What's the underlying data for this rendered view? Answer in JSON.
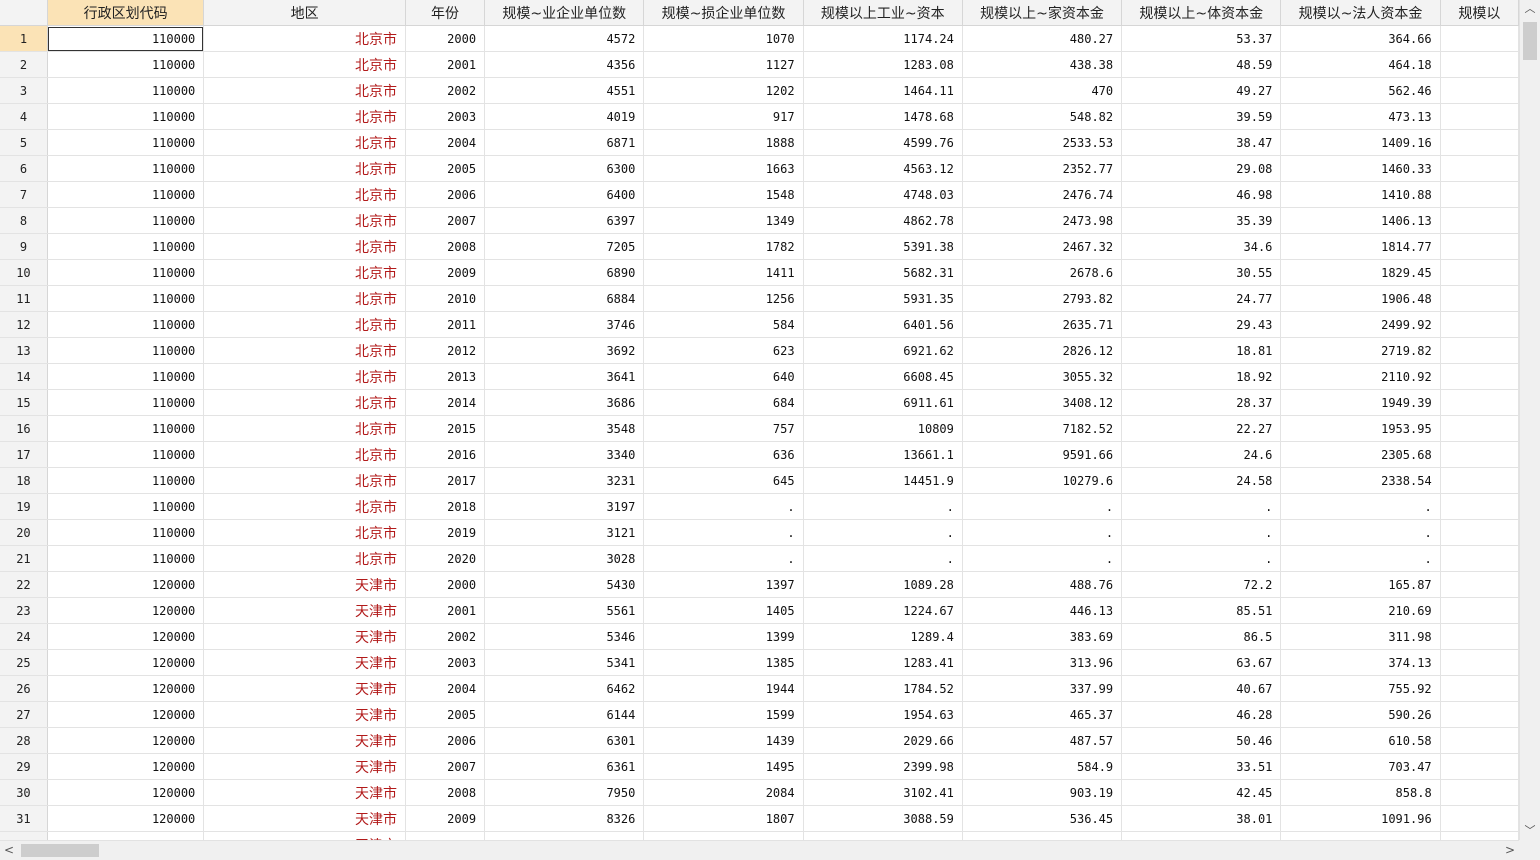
{
  "columns": [
    "行政区划代码",
    "地区",
    "年份",
    "规模~业企业单位数",
    "规模~损企业单位数",
    "规模以上工业~资本",
    "规模以上~家资本金",
    "规模以上~体资本金",
    "规模以~法人资本金",
    "规模以"
  ],
  "rows": [
    [
      "1",
      "110000",
      "北京市",
      "2000",
      "4572",
      "1070",
      "1174.24",
      "480.27",
      "53.37",
      "364.66",
      ""
    ],
    [
      "2",
      "110000",
      "北京市",
      "2001",
      "4356",
      "1127",
      "1283.08",
      "438.38",
      "48.59",
      "464.18",
      ""
    ],
    [
      "3",
      "110000",
      "北京市",
      "2002",
      "4551",
      "1202",
      "1464.11",
      "470",
      "49.27",
      "562.46",
      ""
    ],
    [
      "4",
      "110000",
      "北京市",
      "2003",
      "4019",
      "917",
      "1478.68",
      "548.82",
      "39.59",
      "473.13",
      ""
    ],
    [
      "5",
      "110000",
      "北京市",
      "2004",
      "6871",
      "1888",
      "4599.76",
      "2533.53",
      "38.47",
      "1409.16",
      ""
    ],
    [
      "6",
      "110000",
      "北京市",
      "2005",
      "6300",
      "1663",
      "4563.12",
      "2352.77",
      "29.08",
      "1460.33",
      ""
    ],
    [
      "7",
      "110000",
      "北京市",
      "2006",
      "6400",
      "1548",
      "4748.03",
      "2476.74",
      "46.98",
      "1410.88",
      ""
    ],
    [
      "8",
      "110000",
      "北京市",
      "2007",
      "6397",
      "1349",
      "4862.78",
      "2473.98",
      "35.39",
      "1406.13",
      ""
    ],
    [
      "9",
      "110000",
      "北京市",
      "2008",
      "7205",
      "1782",
      "5391.38",
      "2467.32",
      "34.6",
      "1814.77",
      ""
    ],
    [
      "10",
      "110000",
      "北京市",
      "2009",
      "6890",
      "1411",
      "5682.31",
      "2678.6",
      "30.55",
      "1829.45",
      ""
    ],
    [
      "11",
      "110000",
      "北京市",
      "2010",
      "6884",
      "1256",
      "5931.35",
      "2793.82",
      "24.77",
      "1906.48",
      ""
    ],
    [
      "12",
      "110000",
      "北京市",
      "2011",
      "3746",
      "584",
      "6401.56",
      "2635.71",
      "29.43",
      "2499.92",
      ""
    ],
    [
      "13",
      "110000",
      "北京市",
      "2012",
      "3692",
      "623",
      "6921.62",
      "2826.12",
      "18.81",
      "2719.82",
      ""
    ],
    [
      "14",
      "110000",
      "北京市",
      "2013",
      "3641",
      "640",
      "6608.45",
      "3055.32",
      "18.92",
      "2110.92",
      ""
    ],
    [
      "15",
      "110000",
      "北京市",
      "2014",
      "3686",
      "684",
      "6911.61",
      "3408.12",
      "28.37",
      "1949.39",
      ""
    ],
    [
      "16",
      "110000",
      "北京市",
      "2015",
      "3548",
      "757",
      "10809",
      "7182.52",
      "22.27",
      "1953.95",
      ""
    ],
    [
      "17",
      "110000",
      "北京市",
      "2016",
      "3340",
      "636",
      "13661.1",
      "9591.66",
      "24.6",
      "2305.68",
      ""
    ],
    [
      "18",
      "110000",
      "北京市",
      "2017",
      "3231",
      "645",
      "14451.9",
      "10279.6",
      "24.58",
      "2338.54",
      ""
    ],
    [
      "19",
      "110000",
      "北京市",
      "2018",
      "3197",
      ".",
      ".",
      ".",
      ".",
      ".",
      ""
    ],
    [
      "20",
      "110000",
      "北京市",
      "2019",
      "3121",
      ".",
      ".",
      ".",
      ".",
      ".",
      ""
    ],
    [
      "21",
      "110000",
      "北京市",
      "2020",
      "3028",
      ".",
      ".",
      ".",
      ".",
      ".",
      ""
    ],
    [
      "22",
      "120000",
      "天津市",
      "2000",
      "5430",
      "1397",
      "1089.28",
      "488.76",
      "72.2",
      "165.87",
      ""
    ],
    [
      "23",
      "120000",
      "天津市",
      "2001",
      "5561",
      "1405",
      "1224.67",
      "446.13",
      "85.51",
      "210.69",
      ""
    ],
    [
      "24",
      "120000",
      "天津市",
      "2002",
      "5346",
      "1399",
      "1289.4",
      "383.69",
      "86.5",
      "311.98",
      ""
    ],
    [
      "25",
      "120000",
      "天津市",
      "2003",
      "5341",
      "1385",
      "1283.41",
      "313.96",
      "63.67",
      "374.13",
      ""
    ],
    [
      "26",
      "120000",
      "天津市",
      "2004",
      "6462",
      "1944",
      "1784.52",
      "337.99",
      "40.67",
      "755.92",
      ""
    ],
    [
      "27",
      "120000",
      "天津市",
      "2005",
      "6144",
      "1599",
      "1954.63",
      "465.37",
      "46.28",
      "590.26",
      ""
    ],
    [
      "28",
      "120000",
      "天津市",
      "2006",
      "6301",
      "1439",
      "2029.66",
      "487.57",
      "50.46",
      "610.58",
      ""
    ],
    [
      "29",
      "120000",
      "天津市",
      "2007",
      "6361",
      "1495",
      "2399.98",
      "584.9",
      "33.51",
      "703.47",
      ""
    ],
    [
      "30",
      "120000",
      "天津市",
      "2008",
      "7950",
      "2084",
      "3102.41",
      "903.19",
      "42.45",
      "858.8",
      ""
    ],
    [
      "31",
      "120000",
      "天津市",
      "2009",
      "8326",
      "1807",
      "3088.59",
      "536.45",
      "38.01",
      "1091.96",
      ""
    ]
  ],
  "partial_row_region": "天津市",
  "scrollbar": {
    "up": "︿",
    "down": "﹀",
    "left": "<",
    "right": ">"
  }
}
